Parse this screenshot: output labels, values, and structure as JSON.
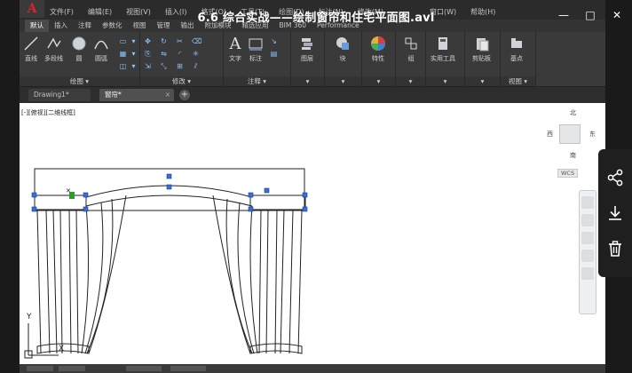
{
  "video": {
    "title": "6.6 综合实战——绘制窗帘和住宅平面图.avi",
    "controls": [
      "—",
      "□",
      "✕"
    ]
  },
  "app": {
    "logo": "A",
    "menus": [
      "文件(F)",
      "编辑(E)",
      "视图(V)",
      "插入(I)",
      "格式(O)",
      "工具(T)",
      "绘图(D)",
      "标注(N)",
      "修改(M)"
    ],
    "menus_right": [
      "窗口(W)",
      "帮助(H)"
    ],
    "ribbon_tabs": [
      "默认",
      "插入",
      "注释",
      "参数化",
      "视图",
      "管理",
      "输出",
      "附加模块",
      "精选应用",
      "BIM 360",
      "Performance"
    ],
    "ribbon_active_tab": "默认",
    "tools": {
      "line": "直线",
      "polyline": "多段线",
      "circle": "圆",
      "arc": "圆弧",
      "text": "文字",
      "dimension": "标注",
      "layer": "图层",
      "block": "块",
      "properties": "特性",
      "group": "组",
      "utilities": "实用工具",
      "clipboard": "剪贴板",
      "basepoint": "基点"
    },
    "groups": {
      "draw": "绘图",
      "modify": "修改",
      "annotation": "注释",
      "view": "视图"
    },
    "doc_tabs": [
      {
        "label": "Drawing1*",
        "active": false
      },
      {
        "label": "窗帘*",
        "active": true
      }
    ],
    "doc_tab_add": "+",
    "viewport_label": "[-][俯视][二维线框]",
    "viewcube": {
      "north": "北",
      "south": "南",
      "west": "西",
      "east": "东",
      "wcs": "WCS"
    },
    "ucs_y": "Y",
    "ucs_x": "X"
  },
  "colors": {
    "accent_red": "#d9232d",
    "canvas_bg": "#ffffff",
    "grip_blue": "#3a6fd8",
    "grip_green": "#2e9b2e"
  }
}
